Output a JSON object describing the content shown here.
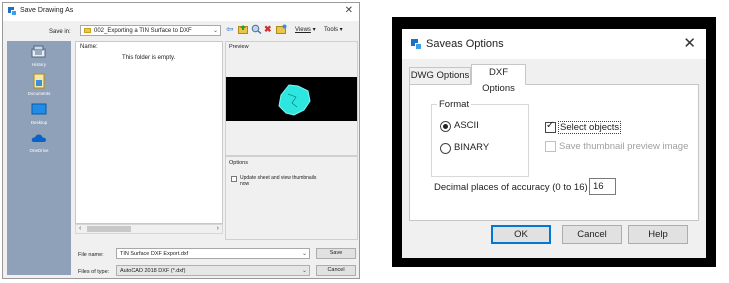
{
  "save_dialog": {
    "title": "Save Drawing As",
    "close_glyph": "✕",
    "save_in_label": "Save in:",
    "path": "002_Exporting a TIN Surface to DXF",
    "toolbar": {
      "views_label": "Views",
      "tools_label": "Tools"
    },
    "places": [
      "History",
      "Documents",
      "Desktop",
      "OneDrive"
    ],
    "name_header": "Name:",
    "empty_message": "This folder is empty.",
    "preview_label": "Preview",
    "options_label": "Options",
    "options_checkbox_label": "Update sheet and view thumbnails now",
    "file_name_label": "File name:",
    "file_name_value": "TIN Surface DXF Export.dxf",
    "file_type_label": "Files of type:",
    "file_type_value": "AutoCAD 2018 DXF (*.dxf)",
    "save_button": "Save",
    "cancel_button": "Cancel"
  },
  "options_dialog": {
    "title": "Saveas Options",
    "close_glyph": "✕",
    "tabs": [
      "DWG Options",
      "DXF Options"
    ],
    "active_tab": "DXF Options",
    "format_label": "Format",
    "format_options": [
      "ASCII",
      "BINARY"
    ],
    "selected_format": "ASCII",
    "select_objects_label": "Select objects",
    "select_objects_checked": true,
    "thumbnail_label": "Save thumbnail preview image",
    "thumbnail_enabled": false,
    "decimal_label": "Decimal places of accuracy (0 to 16)",
    "decimal_value": "16",
    "ok_button": "OK",
    "cancel_button": "Cancel",
    "help_button": "Help"
  },
  "colors": {
    "places_bar": "#8fa1b8",
    "preview_shape": "#2ee6e0",
    "frame": "#000000",
    "default_button_border": "#0078d7"
  }
}
